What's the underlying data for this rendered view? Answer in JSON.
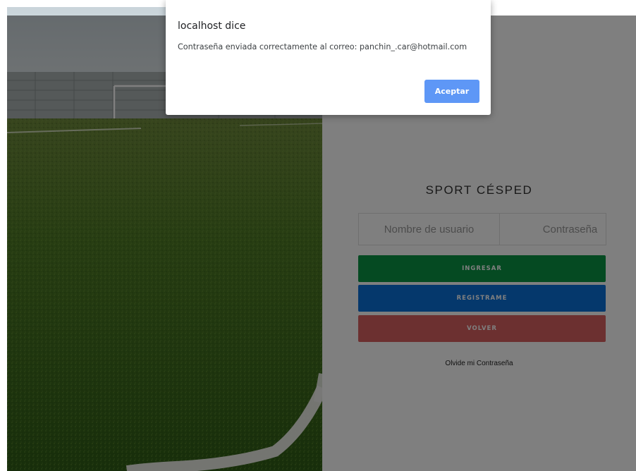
{
  "login": {
    "brand_title": "SPORT CÉSPED",
    "username_placeholder": "Nombre de usuario",
    "password_placeholder": "Contraseña",
    "ingresar_label": "INGRESAR",
    "registrame_label": "REGISTRAME",
    "volver_label": "VOLVER",
    "forgot_label": "Olvide mi Contraseña"
  },
  "dialog": {
    "title": "localhost dice",
    "message": "Contraseña enviada correctamente al correo: panchin_.car@hotmail.com",
    "accept_label": "Aceptar"
  },
  "colors": {
    "ingresar": "#0a9444",
    "registrame": "#0a71d8",
    "volver": "#d96060",
    "accept": "#5e97f6"
  }
}
